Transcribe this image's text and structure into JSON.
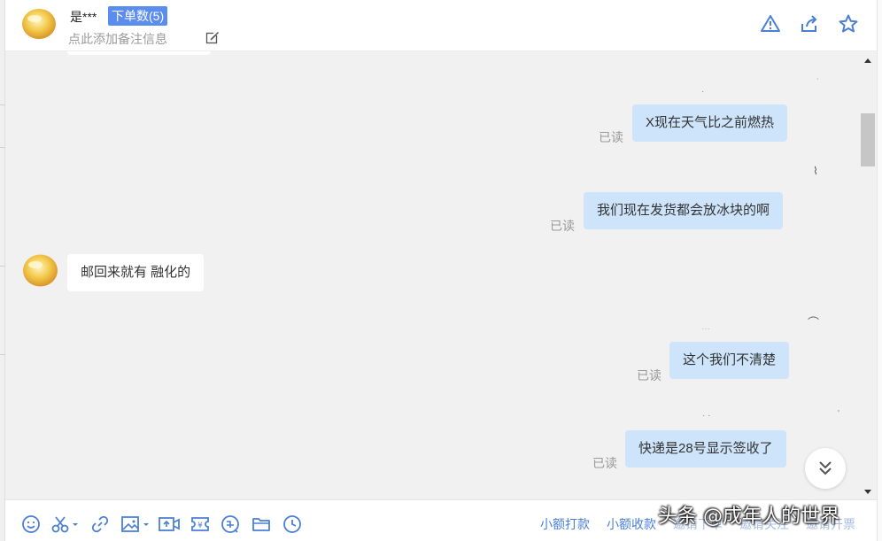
{
  "header": {
    "contact_name": "是***",
    "order_badge": "下单数(5)",
    "remark_placeholder": "点此添加备注信息"
  },
  "messages": [
    {
      "side": "right",
      "text": "X现在天气比之前燃热",
      "status": "已读"
    },
    {
      "side": "right",
      "text": "我们现在发货都会放冰块的啊",
      "status": "已读"
    },
    {
      "side": "left",
      "text": "邮回来就有 融化的"
    },
    {
      "side": "right",
      "text": "这个我们不清楚",
      "status": "已读"
    },
    {
      "side": "right",
      "text": "快递是28号显示签收了",
      "status": "已读"
    }
  ],
  "toolbar": {
    "tools": [
      "emoji-icon",
      "scissors-icon",
      "link-icon",
      "image-icon",
      "video-icon",
      "coupon-icon",
      "refund-icon",
      "folder-icon",
      "clock-icon"
    ],
    "actions": [
      "小额打款",
      "小额收款",
      "邀请下单",
      "邀请关注",
      "邀请开票"
    ]
  },
  "watermark": "头条 @成年人的世界",
  "colors": {
    "accent": "#4a7fd6",
    "badge": "#5b8def",
    "my_bubble": "#cde4fb",
    "chat_bg": "#f1f1f1"
  }
}
